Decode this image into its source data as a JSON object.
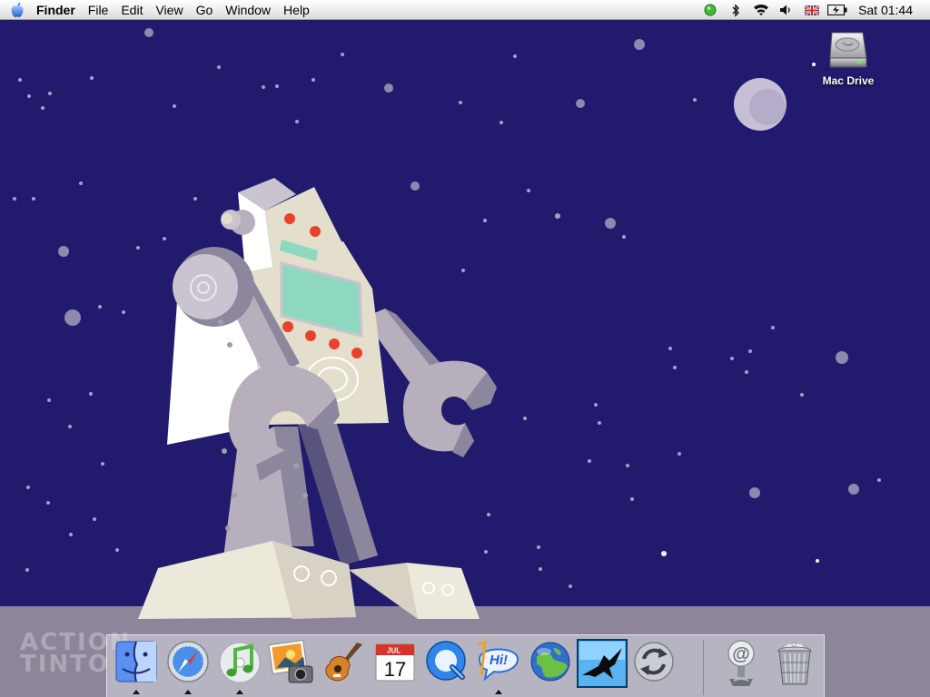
{
  "menubar": {
    "apple_icon": "apple-icon",
    "app_name": "Finder",
    "items": [
      "File",
      "Edit",
      "View",
      "Go",
      "Window",
      "Help"
    ],
    "status_icons": [
      "ichat-status-icon",
      "bluetooth-icon",
      "wifi-icon",
      "volume-icon",
      "uk-flag-icon",
      "battery-icon"
    ],
    "clock": "Sat 01:44"
  },
  "desktop": {
    "drive_label": "Mac Drive",
    "watermark": [
      "ACTION",
      "TINTO"
    ]
  },
  "dock": {
    "items": [
      {
        "name": "Finder",
        "icon": "finder-icon",
        "running": true
      },
      {
        "name": "Safari",
        "icon": "safari-icon",
        "running": true
      },
      {
        "name": "iTunes",
        "icon": "itunes-icon",
        "running": true
      },
      {
        "name": "iPhoto",
        "icon": "iphoto-icon",
        "running": false
      },
      {
        "name": "GarageBand",
        "icon": "garageband-icon",
        "running": false
      },
      {
        "name": "iCal",
        "icon": "ical-icon",
        "running": false,
        "month": "JUL",
        "day": "17"
      },
      {
        "name": "QuickTime Player",
        "icon": "quicktime-icon",
        "running": false
      },
      {
        "name": "iChat",
        "icon": "ichat-icon",
        "running": true,
        "bubble_text": "Hi!"
      },
      {
        "name": "Internet Connect",
        "icon": "globe-icon",
        "running": false
      },
      {
        "name": "Bird App",
        "icon": "bird-icon",
        "running": false
      },
      {
        "name": "Sync",
        "icon": "sync-icon",
        "running": false
      },
      {
        "name": "Mail Downloads",
        "icon": "at-sign-icon",
        "running": false
      },
      {
        "name": "Trash",
        "icon": "trash-icon",
        "running": false
      }
    ]
  },
  "colors": {
    "sky": "#211a6d",
    "ground": "#8d8599",
    "robot_body": "#e3dfcc",
    "robot_limb": "#b7b0bc",
    "robot_screen": "#8fd8c0",
    "robot_lights": "#e8412c"
  }
}
